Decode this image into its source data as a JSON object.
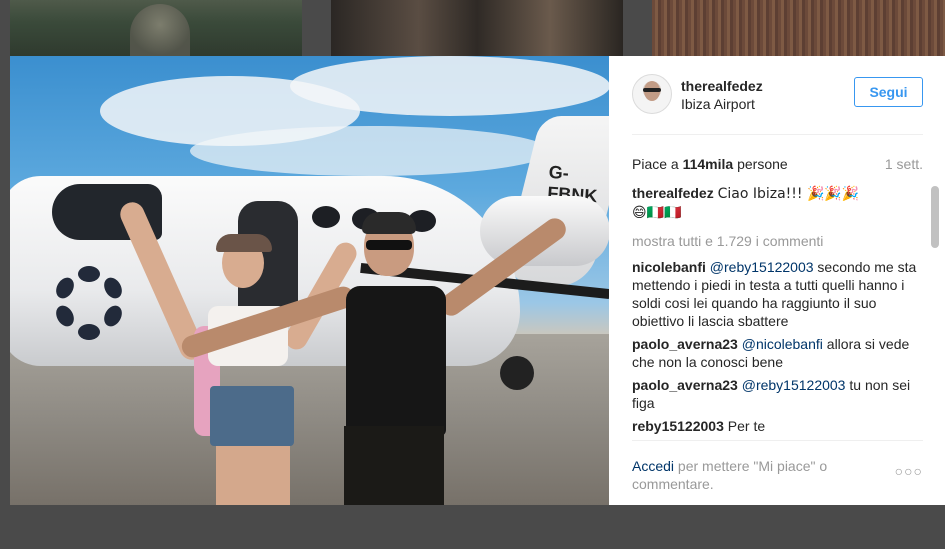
{
  "post": {
    "username": "therealfedez",
    "location": "Ibiza Airport",
    "follow_label": "Segui",
    "likes_prefix": "Piace a ",
    "likes_count": "114mila",
    "likes_suffix": " persone",
    "time_ago": "1 sett.",
    "photo": {
      "registration": "G-FBNK"
    }
  },
  "caption": {
    "username": "therealfedez",
    "text": "Ciao Ibiza!!! 🎉🎉🎉",
    "emoji_line": "😄🇮🇹🇮🇹"
  },
  "show_all_comments": "mostra tutti e 1.729 i commenti",
  "comments": [
    {
      "user": "nicolebanfi",
      "mention": "@reby15122003",
      "text": " secondo me sta mettendo i piedi in testa a tutti quelli hanno i soldi cosi lei quando ha raggiunto il suo obiettivo li lascia sbattere"
    },
    {
      "user": "paolo_averna23",
      "mention": "@nicolebanfi",
      "text": " allora si vede che non la conosci bene"
    },
    {
      "user": "paolo_averna23",
      "mention": "@reby15122003",
      "text": " tu non sei figa"
    },
    {
      "user": "reby15122003",
      "mention": "",
      "text": "Per te"
    }
  ],
  "footer": {
    "login_label": "Accedi",
    "text": " per mettere \"Mi piace\" o commentare.",
    "more_label": "○○○"
  }
}
